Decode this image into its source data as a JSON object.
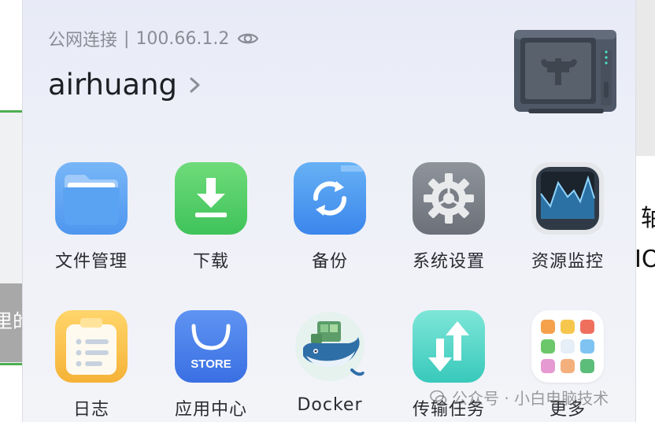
{
  "header": {
    "connection_type": "公网连接",
    "separator": "|",
    "ip_address": "100.66.1.2",
    "username": "airhuang"
  },
  "apps": [
    {
      "label": "文件管理",
      "icon": "folder-icon"
    },
    {
      "label": "下载",
      "icon": "download-icon"
    },
    {
      "label": "备份",
      "icon": "backup-sync-icon"
    },
    {
      "label": "系统设置",
      "icon": "gear-icon"
    },
    {
      "label": "资源监控",
      "icon": "activity-monitor-icon"
    },
    {
      "label": "日志",
      "icon": "log-list-icon"
    },
    {
      "label": "应用中心",
      "icon": "store-bag-icon",
      "badge": "STORE"
    },
    {
      "label": "Docker",
      "icon": "docker-whale-icon"
    },
    {
      "label": "传输任务",
      "icon": "transfer-arrows-icon"
    },
    {
      "label": "更多",
      "icon": "grid-more-icon"
    }
  ],
  "watermark": "公众号 · 小白电脑技术",
  "background": {
    "left_text": "里的",
    "right_text_1": "轴",
    "right_text_2": "IO"
  },
  "colors": {
    "panel_bg": "#eceff8",
    "accent_green": "#4caf50",
    "text_primary": "#1e1f24",
    "text_secondary": "#8a8d96"
  }
}
